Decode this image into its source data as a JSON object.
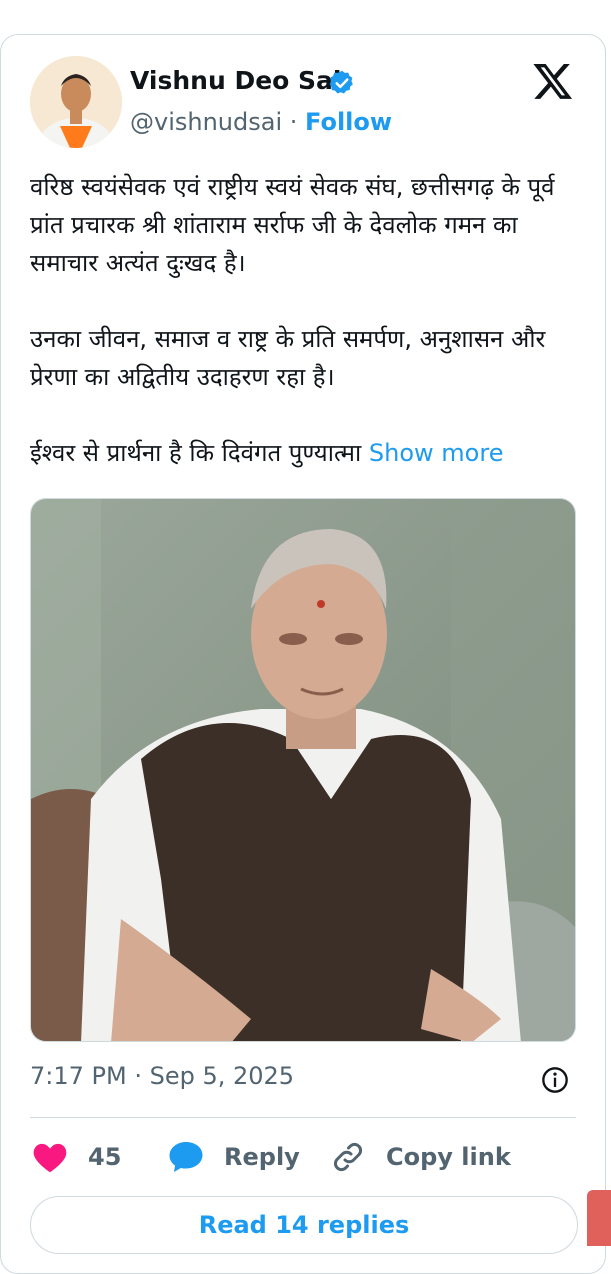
{
  "author": {
    "name": "Vishnu Deo Sai",
    "handle": "@vishnudsai",
    "separator": "·",
    "follow_label": "Follow"
  },
  "icons": {
    "verified": "verified-badge-icon",
    "platform": "x-logo-icon",
    "info": "info-icon",
    "like": "heart-icon",
    "reply": "speech-bubble-icon",
    "copy": "link-icon"
  },
  "tweet": {
    "paragraph_1": "वरिष्ठ स्वयंसेवक एवं राष्ट्रीय स्वयं सेवक संघ, छत्तीसगढ़ के पूर्व प्रांत प्रचारक श्री शांताराम सर्राफ जी के देवलोक गमन का समाचार अत्यंत दुःखद है।",
    "paragraph_2": "उनका जीवन, समाज व राष्ट्र के प्रति समर्पण, अनुशासन और प्रेरणा का अद्वितीय उदाहरण रहा है।",
    "paragraph_3": "ईश्वर से प्रार्थना है कि दिवंगत पुण्यात्मा",
    "show_more_label": "Show more",
    "timestamp": "7:17 PM · Sep 5, 2025"
  },
  "actions": {
    "like_count": "45",
    "reply_label": "Reply",
    "copy_label": "Copy link",
    "read_replies_label": "Read 14 replies"
  },
  "colors": {
    "accent": "#1d9bf0",
    "like": "#f91880",
    "muted_text": "#536471",
    "border": "#cfd9de"
  }
}
